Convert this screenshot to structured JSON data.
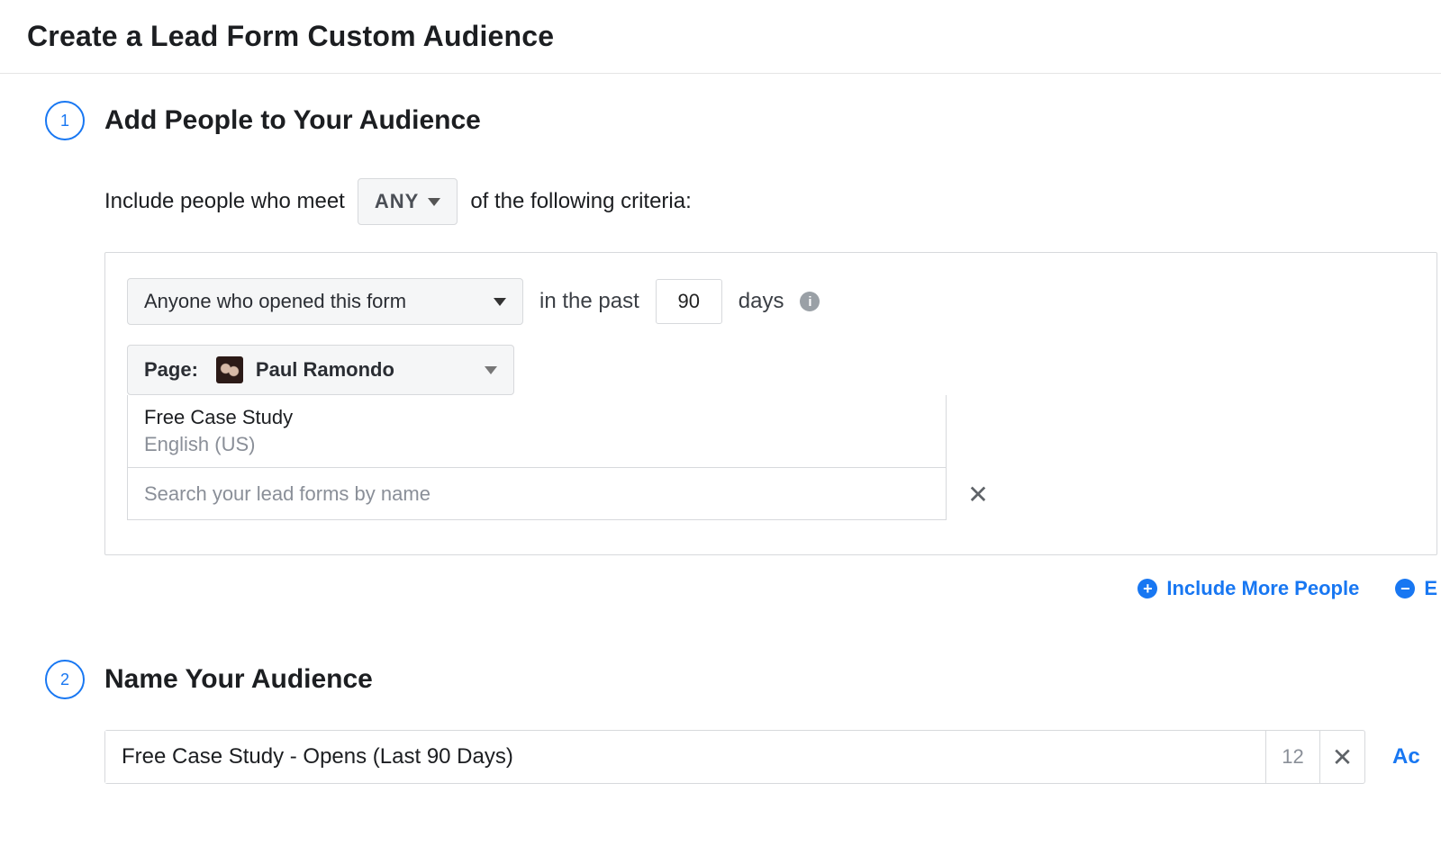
{
  "title": "Create a Lead Form Custom Audience",
  "step1": {
    "number": "1",
    "heading": "Add People to Your Audience",
    "include_text_pre": "Include people who meet",
    "any_label": "ANY",
    "include_text_post": "of the following criteria:",
    "criteria": {
      "engagement_option": "Anyone who opened this form",
      "in_the_past_label": "in the past",
      "days_value": "90",
      "days_label": "days",
      "page_prefix": "Page:",
      "page_name": "Paul Ramondo",
      "selected_form": {
        "name": "Free Case Study",
        "locale": "English (US)"
      },
      "search_placeholder": "Search your lead forms by name"
    },
    "include_more_label": "Include More People",
    "exclude_leading_letter": "E"
  },
  "step2": {
    "number": "2",
    "heading": "Name Your Audience",
    "name_value": "Free Case Study - Opens (Last 90 Days)",
    "char_remaining": "12",
    "trailing_link_visible": "Ac"
  }
}
